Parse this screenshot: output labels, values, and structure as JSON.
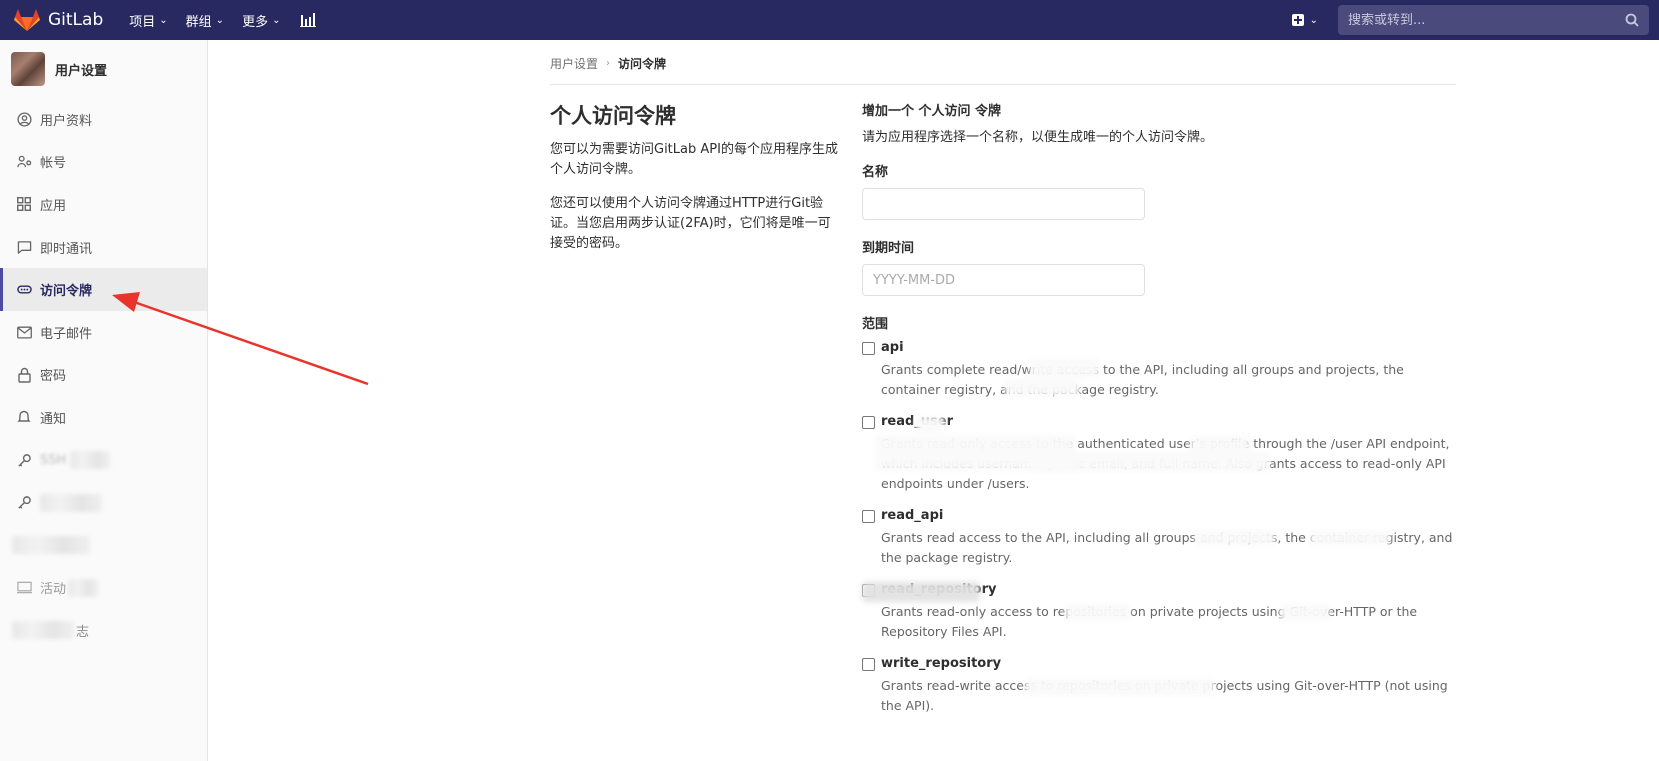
{
  "navbar": {
    "logo_text": "GitLab",
    "menu": [
      {
        "label": "项目"
      },
      {
        "label": "群组"
      },
      {
        "label": "更多"
      }
    ],
    "search_placeholder": "搜索或转到...",
    "colors": {
      "background": "#292961",
      "logo_orange": "#e24329"
    }
  },
  "sidebar": {
    "title": "用户设置",
    "items": [
      {
        "label": "用户资料",
        "icon": "user-icon"
      },
      {
        "label": "帐号",
        "icon": "account-icon"
      },
      {
        "label": "应用",
        "icon": "applications-icon"
      },
      {
        "label": "即时通讯",
        "icon": "chat-icon"
      },
      {
        "label": "访问令牌",
        "icon": "token-icon",
        "active": true
      },
      {
        "label": "电子邮件",
        "icon": "mail-icon"
      },
      {
        "label": "密码",
        "icon": "lock-icon"
      },
      {
        "label": "通知",
        "icon": "bell-icon"
      },
      {
        "label": "SSH",
        "icon": "key-icon"
      },
      {
        "label": "",
        "icon": "key-icon"
      },
      {
        "label": "",
        "icon": "preferences-icon"
      },
      {
        "label": "活动",
        "icon": "session-icon"
      },
      {
        "label": "志",
        "icon": "log-icon"
      }
    ]
  },
  "breadcrumb": {
    "parent": "用户设置",
    "current": "访问令牌"
  },
  "intro": {
    "title": "个人访问令牌",
    "paragraph1": "您可以为需要访问GitLab API的每个应用程序生成个人访问令牌。",
    "paragraph2": "您还可以使用个人访问令牌通过HTTP进行Git验证。当您启用两步认证(2FA)时，它们将是唯一可接受的密码。"
  },
  "form": {
    "heading": "增加一个 个人访问 令牌",
    "subheading": "请为应用程序选择一个名称，以便生成唯一的个人访问令牌。",
    "name_label": "名称",
    "name_value": "",
    "expiry_label": "到期时间",
    "expiry_placeholder": "YYYY-MM-DD",
    "scopes_label": "范围",
    "scopes": [
      {
        "name": "api",
        "description": "Grants complete read/write access to the API, including all groups and projects, the container registry, and the package registry.",
        "checked": false
      },
      {
        "name": "read_user",
        "description": "Grants read-only access to the authenticated user's profile through the /user API endpoint, which includes username, public email, and full name. Also grants access to read-only API endpoints under /users.",
        "checked": false
      },
      {
        "name": "read_api",
        "description": "Grants read access to the API, including all groups and projects, the container registry, and the package registry.",
        "checked": false
      },
      {
        "name": "read_repository",
        "description": "Grants read-only access to repositories on private projects using Git-over-HTTP or the Repository Files API.",
        "checked": false
      },
      {
        "name": "write_repository",
        "description": "Grants read-write access to repositories on private projects using Git-over-HTTP (not using the API).",
        "checked": false
      }
    ]
  },
  "annotation": {
    "arrow_color": "#e8342a"
  }
}
